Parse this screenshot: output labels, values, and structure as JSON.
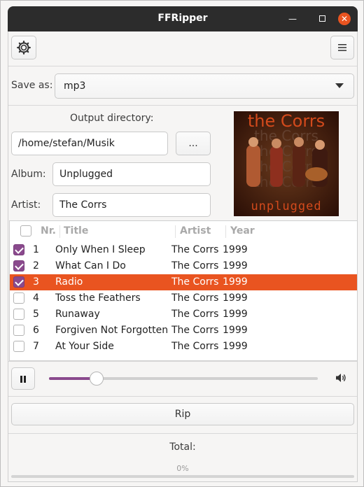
{
  "window": {
    "title": "FFRipper"
  },
  "toolbar": {
    "settings_icon": "gear-icon",
    "menu_icon": "hamburger-menu-icon"
  },
  "save_as": {
    "label": "Save as:",
    "value": "mp3"
  },
  "output": {
    "label": "Output directory:",
    "path": "/home/stefan/Musik",
    "browse_label": "..."
  },
  "album": {
    "label": "Album:",
    "value": "Unplugged"
  },
  "artist": {
    "label": "Artist:",
    "value": "The Corrs"
  },
  "cover": {
    "top_text": "the Corrs",
    "bottom_text": "unplugged"
  },
  "tracks": {
    "columns": [
      "Nr.",
      "Title",
      "Artist",
      "Year"
    ],
    "rows": [
      {
        "checked": true,
        "nr": "1",
        "title": "Only When I Sleep",
        "artist": "The Corrs",
        "year": "1999"
      },
      {
        "checked": true,
        "nr": "2",
        "title": "What Can I Do",
        "artist": "The Corrs",
        "year": "1999"
      },
      {
        "checked": true,
        "nr": "3",
        "title": "Radio",
        "artist": "The Corrs",
        "year": "1999",
        "selected": true
      },
      {
        "checked": false,
        "nr": "4",
        "title": "Toss the Feathers",
        "artist": "The Corrs",
        "year": "1999"
      },
      {
        "checked": false,
        "nr": "5",
        "title": "Runaway",
        "artist": "The Corrs",
        "year": "1999"
      },
      {
        "checked": false,
        "nr": "6",
        "title": "Forgiven Not Forgotten",
        "artist": "The Corrs",
        "year": "1999"
      },
      {
        "checked": false,
        "nr": "7",
        "title": "At Your Side",
        "artist": "The Corrs",
        "year": "1999"
      }
    ]
  },
  "player": {
    "position": 0.15
  },
  "rip": {
    "label": "Rip"
  },
  "total": {
    "label": "Total:",
    "progress_text": "0%"
  },
  "colors": {
    "accent": "#e95420",
    "check": "#8a4a8d"
  }
}
